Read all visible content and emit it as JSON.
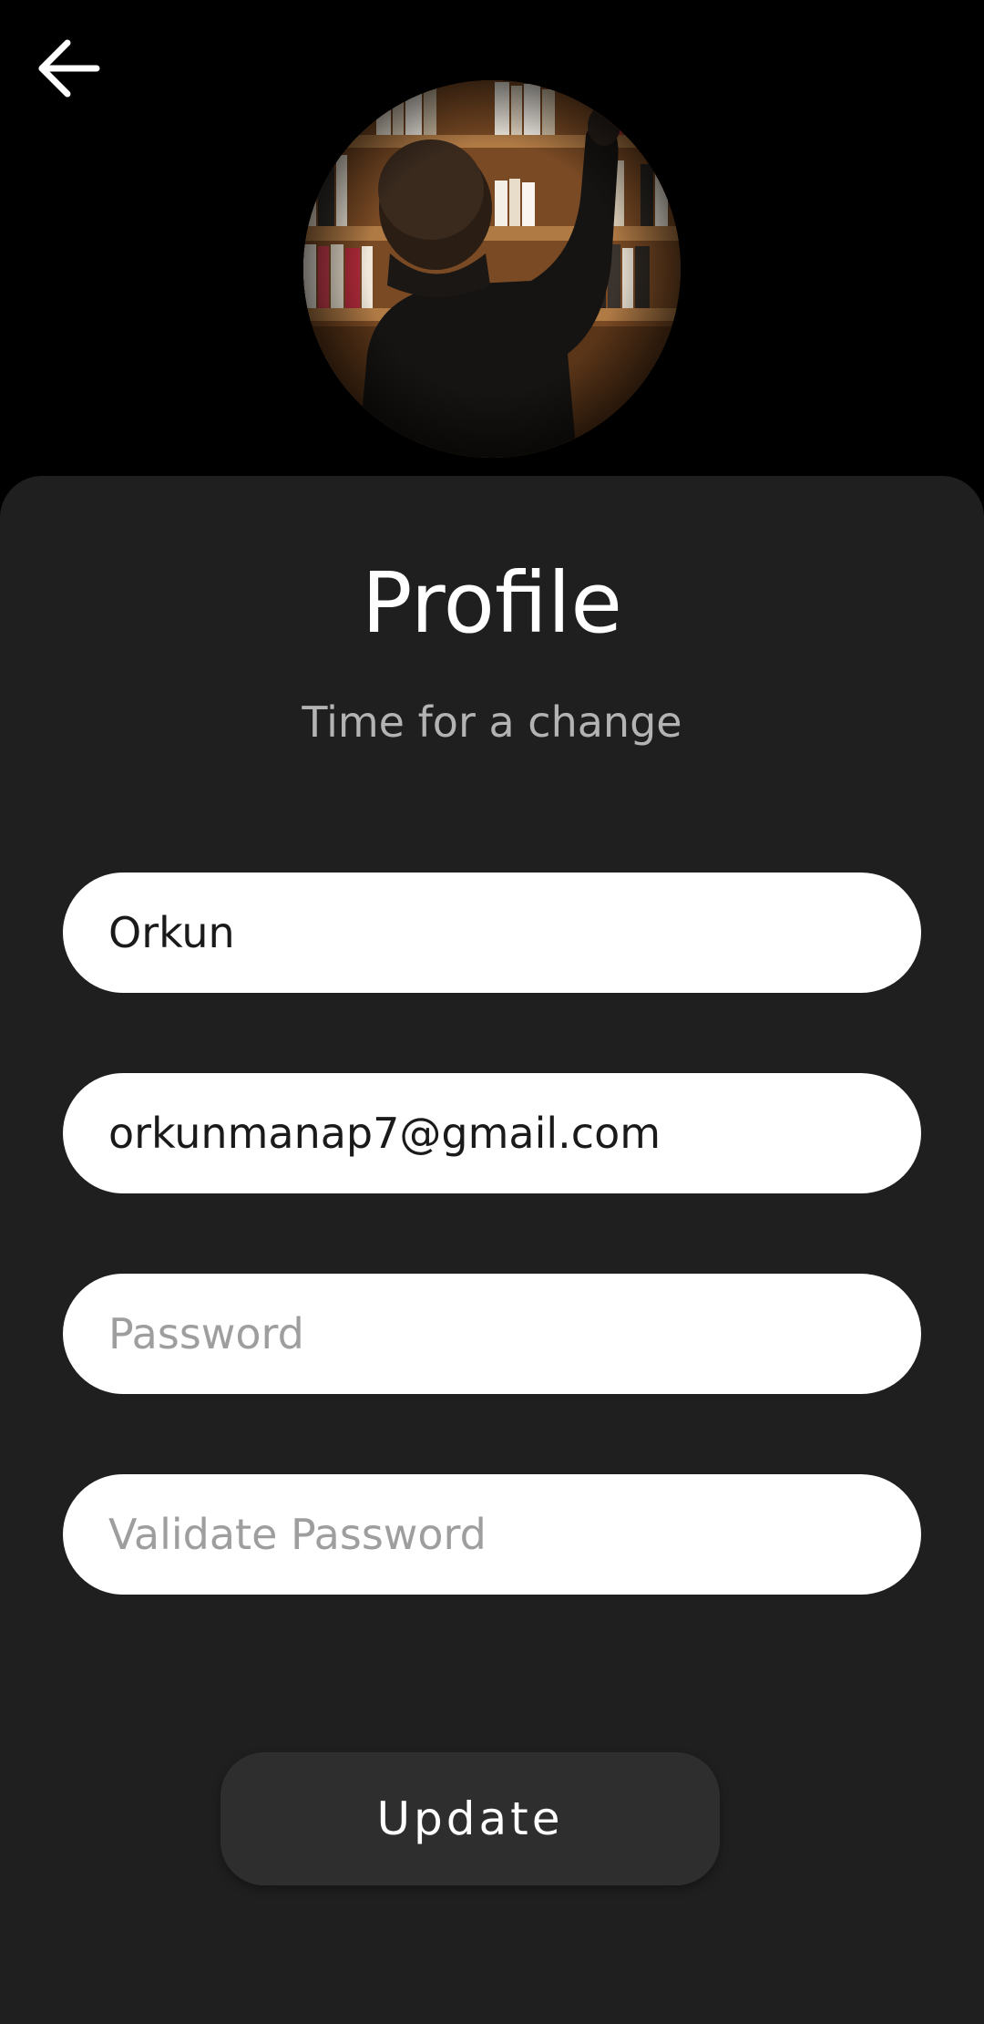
{
  "header": {
    "back_icon": "arrow-left-icon",
    "avatar_icon": "profile-photo"
  },
  "profile": {
    "title": "Profile",
    "subtitle": "Time for a change"
  },
  "form": {
    "name_value": "Orkun",
    "email_value": "orkunmanap7@gmail.com",
    "password_placeholder": "Password",
    "validate_password_placeholder": "Validate Password"
  },
  "actions": {
    "update_label": "Update"
  },
  "colors": {
    "background": "#000000",
    "card": "#1f1f1f",
    "field": "#ffffff",
    "button": "#2e2e2e",
    "subtitle": "#b3b3b3",
    "placeholder": "#9e9e9e"
  }
}
